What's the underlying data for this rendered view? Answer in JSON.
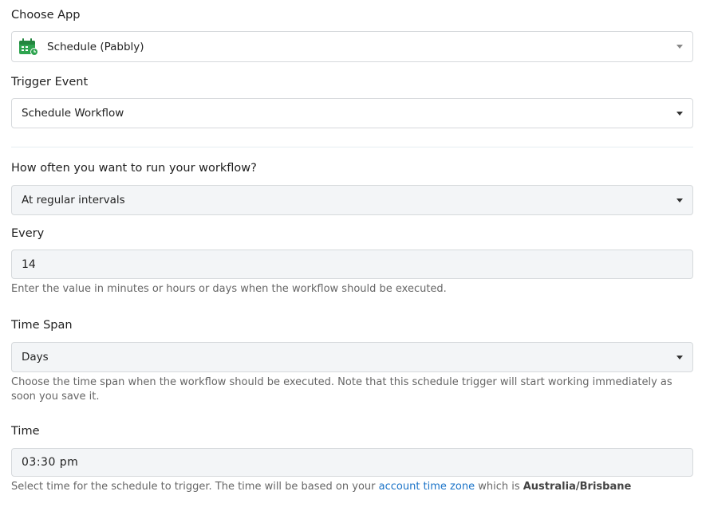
{
  "choose_app": {
    "label": "Choose App",
    "value": "Schedule (Pabbly)",
    "icon": "calendar-clock-icon",
    "icon_color": "#2ea44f"
  },
  "trigger_event": {
    "label": "Trigger Event",
    "value": "Schedule Workflow"
  },
  "frequency": {
    "label": "How often you want to run your workflow?",
    "value": "At regular intervals"
  },
  "every": {
    "label": "Every",
    "value": "14",
    "help": "Enter the value in minutes or hours or days when the workflow should be executed."
  },
  "time_span": {
    "label": "Time Span",
    "value": "Days",
    "help": "Choose the time span when the workflow should be executed. Note that this schedule trigger will start working immediately as soon you save it."
  },
  "time": {
    "label": "Time",
    "value": "03:30 pm",
    "help_prefix": "Select time for the schedule to trigger. The time will be based on your ",
    "help_link": "account time zone",
    "help_middle": " which is ",
    "help_timezone": "Australia/Brisbane"
  },
  "colors": {
    "link": "#1a73c8",
    "field_gray": "#f3f5f7",
    "border": "#d6d9dc"
  }
}
